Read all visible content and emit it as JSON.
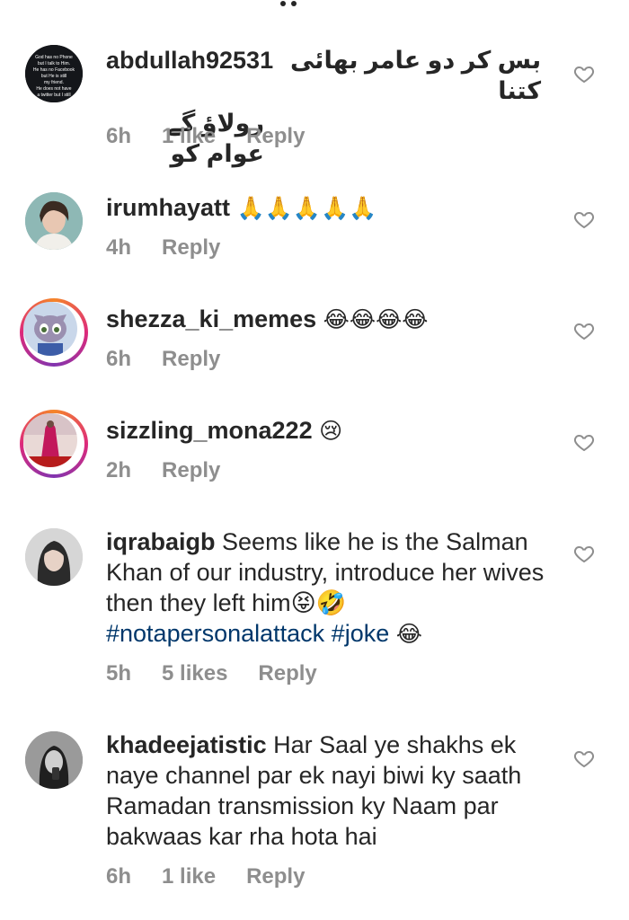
{
  "comments": [
    {
      "username": "abdullah92531",
      "text_line1": "بس کر دو عامر بھائی کتنا",
      "text_line2": "رولاؤ گے عوام کو",
      "time": "6h",
      "likes": "1 like",
      "reply": "Reply",
      "avatar_text": "God has no Phone but I talk to Him. He has no Facebook but He is still my friend. He does not have a twitter but I still follow Him."
    },
    {
      "username": "irumhayatt",
      "text": "🙏🙏🙏🙏🙏",
      "time": "4h",
      "reply": "Reply"
    },
    {
      "username": "shezza_ki_memes",
      "text": "😂😂😂😂",
      "time": "6h",
      "reply": "Reply"
    },
    {
      "username": "sizzling_mona222",
      "text": "😢",
      "time": "2h",
      "reply": "Reply"
    },
    {
      "username": "iqrabaigb",
      "text": "Seems like he is the Salman Khan of our industry, introduce her wives then they left him😝🤣",
      "tags": "#notapersonalattack #joke",
      "tag_emoji": "😂",
      "time": "5h",
      "likes": "5 likes",
      "reply": "Reply"
    },
    {
      "username": "khadeejatistic",
      "text": "Har Saal ye shakhs ek naye channel par ek nayi biwi ky saath Ramadan transmission ky Naam par bakwaas kar rha hota hai",
      "time": "6h",
      "likes": "1 like",
      "reply": "Reply"
    }
  ],
  "icons": {
    "like": "heart-outline-icon"
  },
  "colors": {
    "text": "#262626",
    "meta": "#8e8e8e",
    "hashtag": "#00376b"
  }
}
